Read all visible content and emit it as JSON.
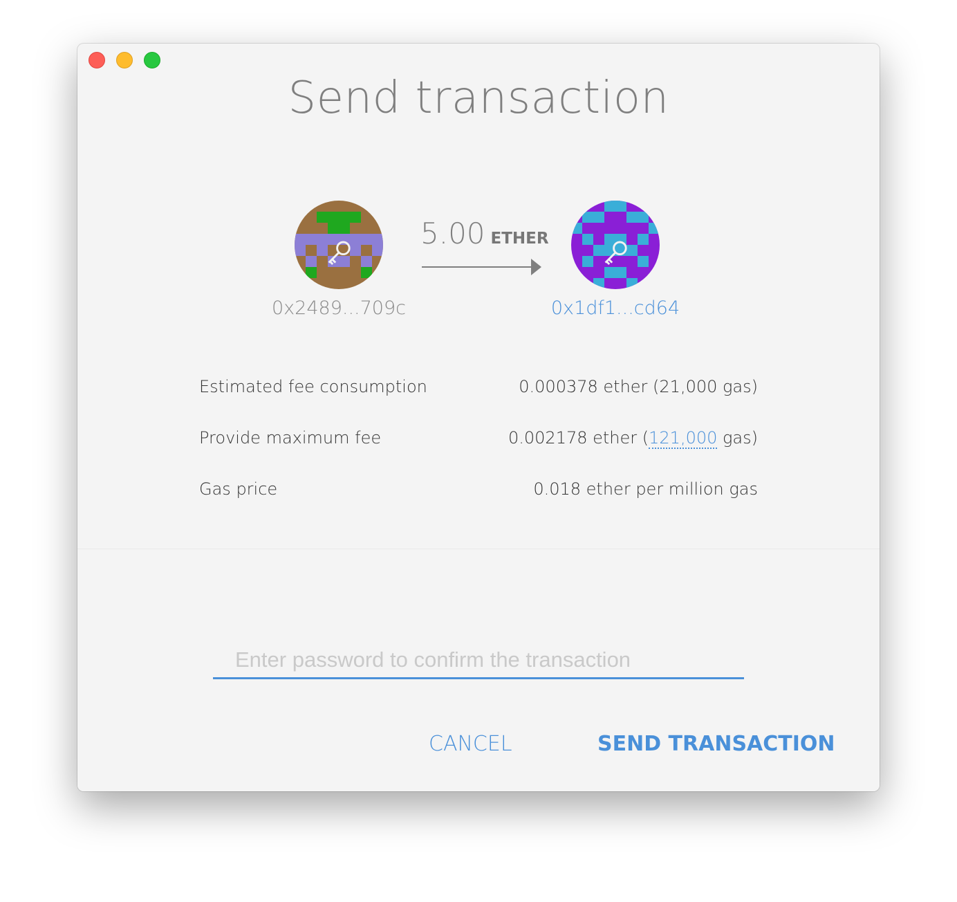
{
  "window": {
    "title": "Send transaction"
  },
  "transfer": {
    "from_address": "0x2489...709c",
    "to_address": "0x1df1...cd64",
    "amount": "5.00",
    "unit": "ETHER"
  },
  "fees": {
    "estimated_label": "Estimated fee consumption",
    "estimated_value": "0.000378 ether (21,000 gas)",
    "maximum_label": "Provide maximum fee",
    "maximum_value_prefix": "0.002178 ether (",
    "maximum_gas": "121,000",
    "maximum_value_suffix": " gas)",
    "gas_price_label": "Gas price",
    "gas_price_value": "0.018 ether per million gas"
  },
  "password": {
    "placeholder": "Enter password to confirm the transaction",
    "value": ""
  },
  "actions": {
    "cancel_label": "CANCEL",
    "send_label": "SEND TRANSACTION"
  },
  "colors": {
    "accent": "#4a90d9",
    "background": "#f4f4f4",
    "title": "#7f7f7f",
    "close": "#fd5e57",
    "minimize": "#febc2e",
    "zoom": "#28c840"
  },
  "icons": {
    "from_avatar": "identicon-key-icon",
    "to_avatar": "identicon-key-icon",
    "arrow": "right-arrow-icon"
  }
}
